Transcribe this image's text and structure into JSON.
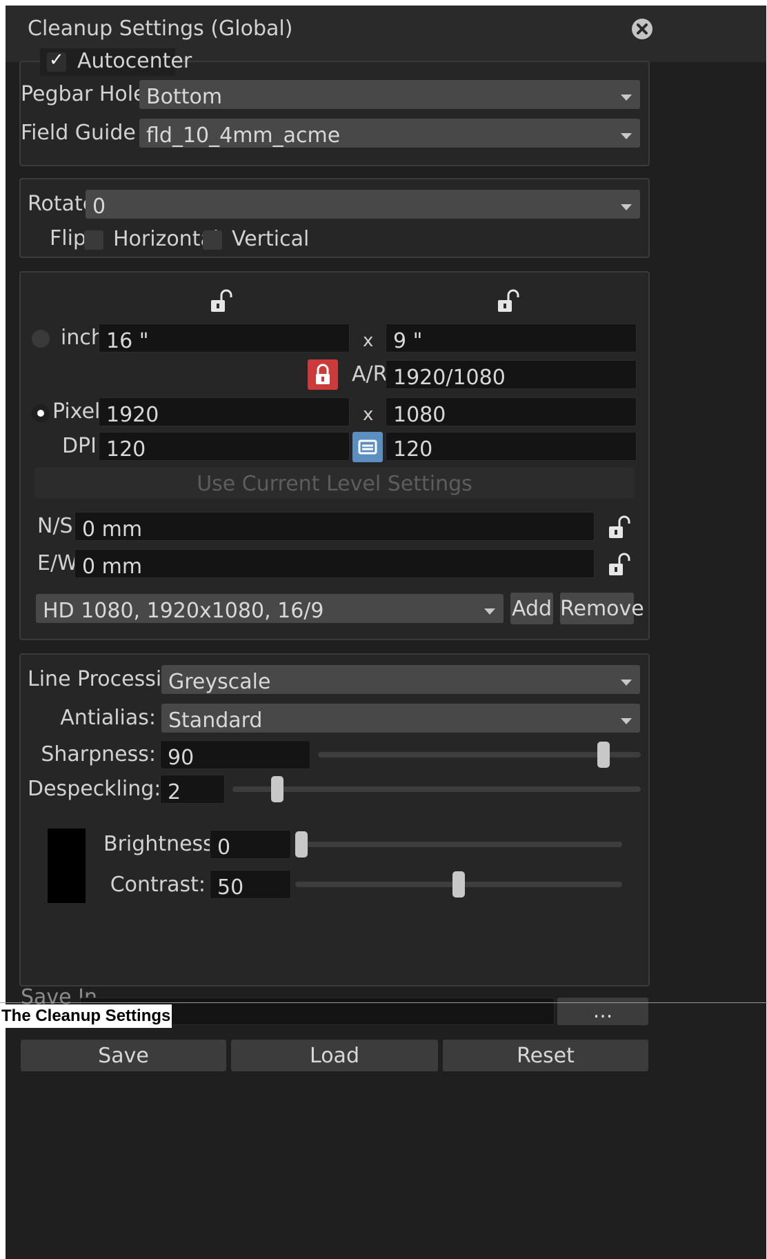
{
  "window": {
    "title": "Cleanup Settings (Global)"
  },
  "autocenter": {
    "label": "Autocenter",
    "checked": true,
    "check_glyph": "✓"
  },
  "pegbar": {
    "label": "Pegbar Holes",
    "value": "Bottom"
  },
  "field_guide": {
    "label": "Field Guide",
    "value": "fld_10_4mm_acme"
  },
  "rotate": {
    "label": "Rotate",
    "value": "0"
  },
  "flip": {
    "label": "Flip",
    "horizontal_label": "Horizontal",
    "vertical_label": "Vertical",
    "horizontal_checked": false,
    "vertical_checked": false
  },
  "camera": {
    "inch_label": "inch",
    "inch_w": "16 \"",
    "inch_h": "9 \"",
    "x_label": "x",
    "ar_label": "A/R",
    "ar_value": "1920/1080",
    "pixels_label": "Pixels",
    "pixels_w": "1920",
    "pixels_h": "1080",
    "dpi_label": "DPI",
    "dpi_x": "120",
    "dpi_y": "120",
    "use_current_label": "Use Current Level Settings",
    "ns_label": "N/S",
    "ns_value": "0 mm",
    "ew_label": "E/W",
    "ew_value": "0 mm",
    "preset_value": "HD 1080, 1920x1080, 16/9",
    "add_label": "Add",
    "remove_label": "Remove",
    "selected_unit": "Pixels"
  },
  "processing": {
    "line_label": "Line Processing:",
    "line_value": "Greyscale",
    "antialias_label": "Antialias:",
    "antialias_value": "Standard",
    "sharpness_label": "Sharpness:",
    "sharpness_value": "90",
    "despeckling_label": "Despeckling:",
    "despeckling_value": "2",
    "brightness_label": "Brightness:",
    "brightness_value": "0",
    "contrast_label": "Contrast:",
    "contrast_value": "50",
    "swatch_color": "#000000"
  },
  "footer": {
    "save_in_label": "Save In",
    "save_in_value": "",
    "browse_label": "...",
    "save_label": "Save",
    "load_label": "Load",
    "reset_label": "Reset"
  },
  "caption": "The Cleanup Settings",
  "colors": {
    "panel_bg": "#1f1f1f",
    "field_bg": "#141414",
    "combo_bg": "#484848",
    "lock_active": "#cc3b3b",
    "link_button": "#5b8fc0"
  }
}
